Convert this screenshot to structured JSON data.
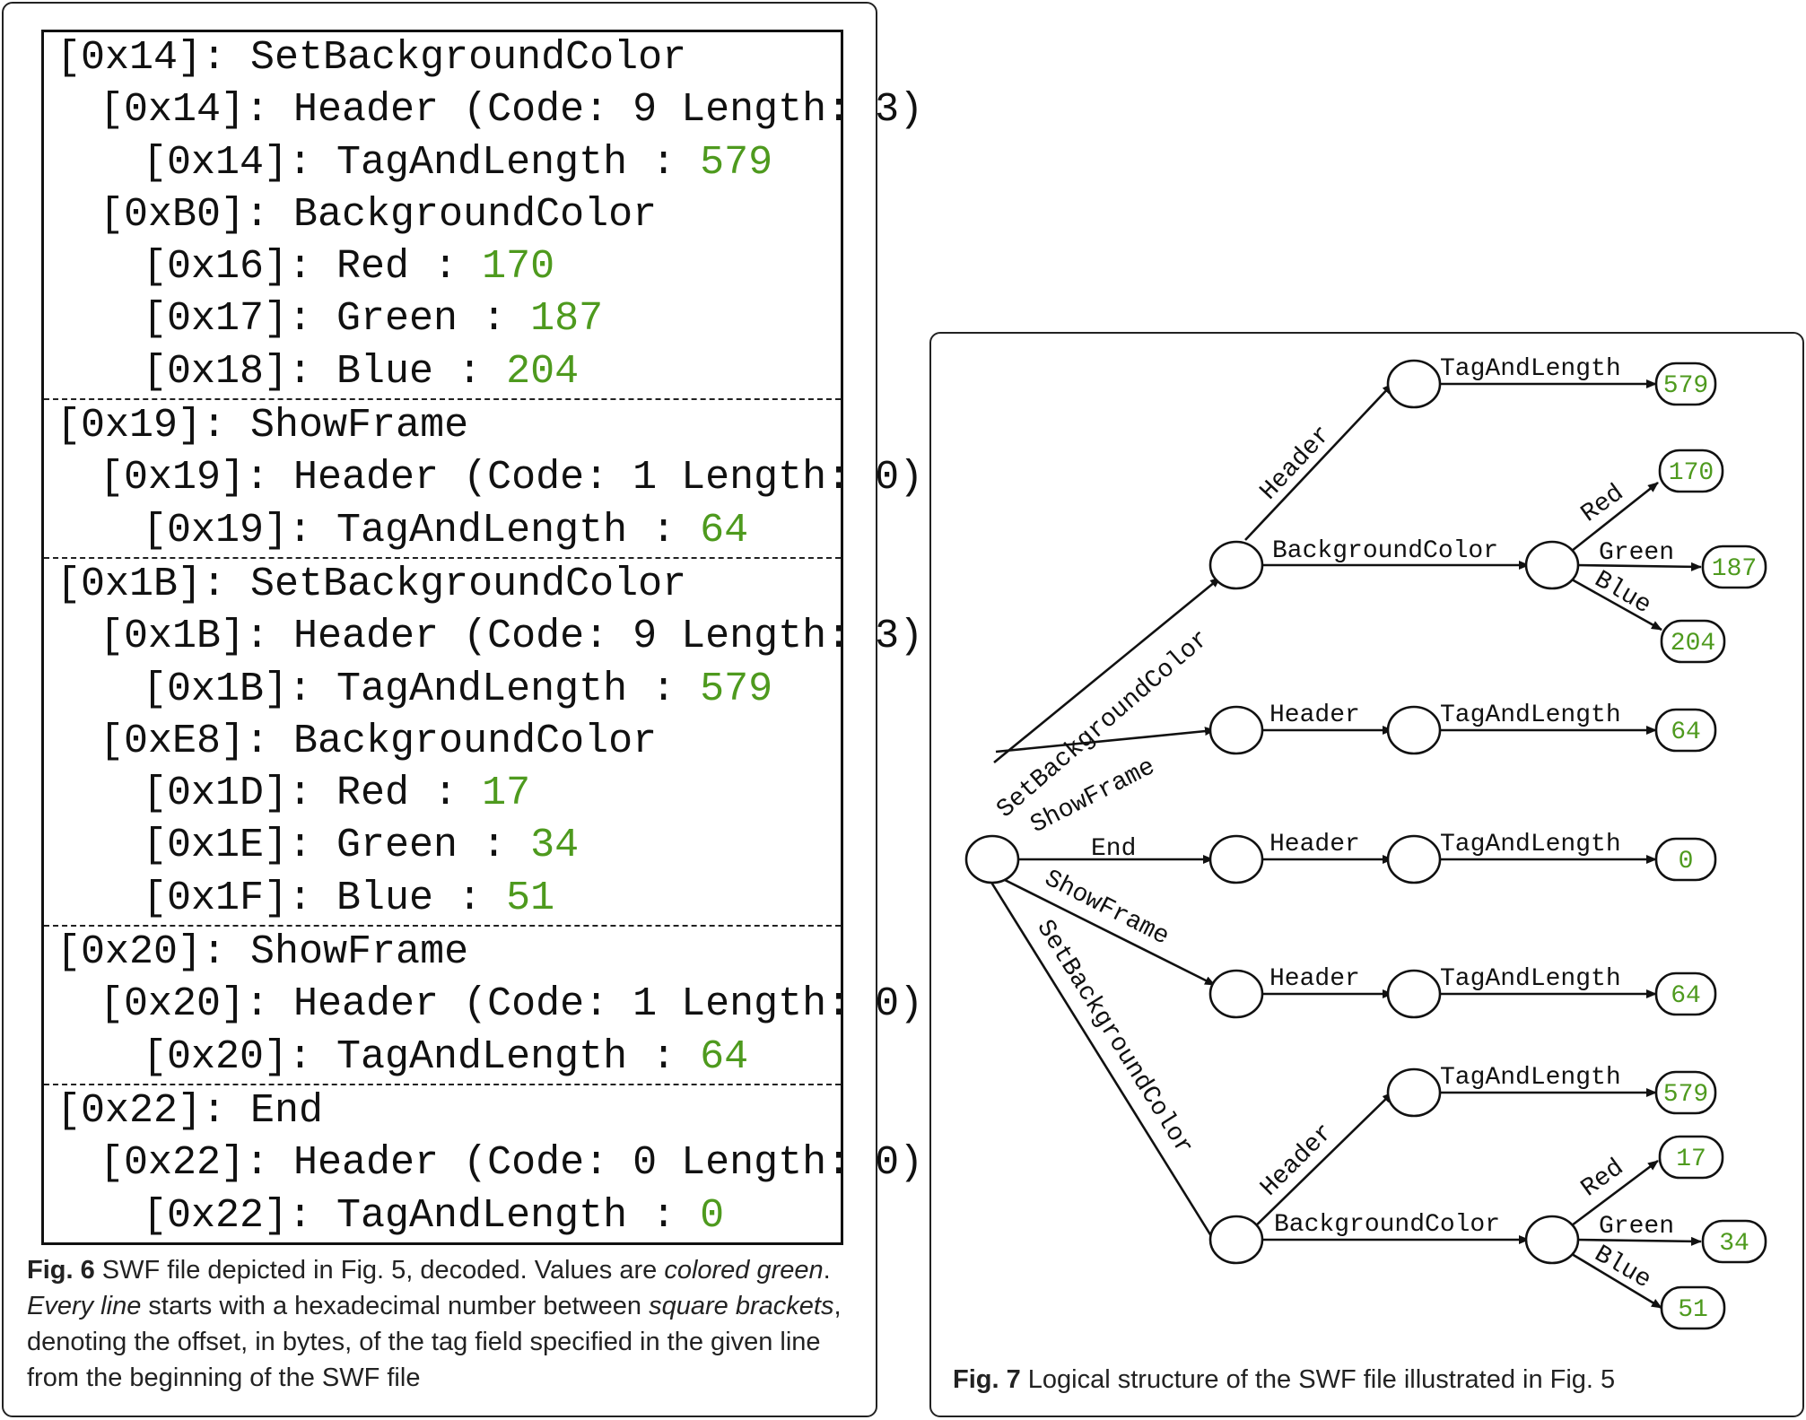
{
  "fig6": {
    "sections": [
      {
        "lines": [
          {
            "level": 0,
            "text": "[0x14]: SetBackgroundColor",
            "value": ""
          },
          {
            "level": 1,
            "text": "[0x14]: Header (Code: 9 Length: 3)",
            "value": ""
          },
          {
            "level": 2,
            "text": "[0x14]: TagAndLength : ",
            "value": "579"
          },
          {
            "level": 1,
            "text": "[0xB0]: BackgroundColor",
            "value": ""
          },
          {
            "level": 2,
            "text": "[0x16]: Red : ",
            "value": "170"
          },
          {
            "level": 2,
            "text": "[0x17]: Green : ",
            "value": "187"
          },
          {
            "level": 2,
            "text": "[0x18]: Blue : ",
            "value": "204"
          }
        ]
      },
      {
        "lines": [
          {
            "level": 0,
            "text": "[0x19]: ShowFrame",
            "value": ""
          },
          {
            "level": 1,
            "text": "[0x19]: Header (Code: 1 Length: 0)",
            "value": ""
          },
          {
            "level": 2,
            "text": "[0x19]: TagAndLength : ",
            "value": "64"
          }
        ]
      },
      {
        "lines": [
          {
            "level": 0,
            "text": "[0x1B]: SetBackgroundColor",
            "value": ""
          },
          {
            "level": 1,
            "text": "[0x1B]: Header (Code: 9 Length: 3)",
            "value": ""
          },
          {
            "level": 2,
            "text": "[0x1B]: TagAndLength : ",
            "value": "579"
          },
          {
            "level": 1,
            "text": "[0xE8]: BackgroundColor",
            "value": ""
          },
          {
            "level": 2,
            "text": "[0x1D]: Red : ",
            "value": "17"
          },
          {
            "level": 2,
            "text": "[0x1E]: Green : ",
            "value": "34"
          },
          {
            "level": 2,
            "text": "[0x1F]: Blue : ",
            "value": "51"
          }
        ]
      },
      {
        "lines": [
          {
            "level": 0,
            "text": "[0x20]: ShowFrame",
            "value": ""
          },
          {
            "level": 1,
            "text": "[0x20]: Header (Code: 1 Length: 0)",
            "value": ""
          },
          {
            "level": 2,
            "text": "[0x20]: TagAndLength : ",
            "value": "64"
          }
        ]
      },
      {
        "lines": [
          {
            "level": 0,
            "text": "[0x22]: End",
            "value": ""
          },
          {
            "level": 1,
            "text": "[0x22]: Header (Code: 0 Length: 0)",
            "value": ""
          },
          {
            "level": 2,
            "text": "[0x22]: TagAndLength : ",
            "value": "0"
          }
        ]
      }
    ],
    "caption": {
      "label": "Fig. 6",
      "t1": " SWF file depicted in Fig. 5, decoded. Values are ",
      "i1": "colored green",
      "t2": ".",
      "i2": "Every line",
      "t3": " starts with a hexadecimal number between ",
      "i3": "square brackets",
      "t4": ", denoting the offset, in bytes, of the tag field specified in the given line from the beginning of the SWF file"
    }
  },
  "fig7": {
    "caption": {
      "label": "Fig. 7",
      "text": " Logical structure of the SWF file illustrated in Fig. 5"
    },
    "edge_labels": {
      "set_background_color": "SetBackgroundColor",
      "show_frame": "ShowFrame",
      "end": "End",
      "header": "Header",
      "tag_and_length": "TagAndLength",
      "background_color": "BackgroundColor",
      "red": "Red",
      "green": "Green",
      "blue": "Blue"
    },
    "leaf_values": {
      "sbc1_tag": "579",
      "sbc1_red": "170",
      "sbc1_green": "187",
      "sbc1_blue": "204",
      "sf1_tag": "64",
      "end_tag": "0",
      "sf2_tag": "64",
      "sbc2_tag": "579",
      "sbc2_red": "17",
      "sbc2_green": "34",
      "sbc2_blue": "51"
    },
    "value_color": "#4e9a1e"
  }
}
